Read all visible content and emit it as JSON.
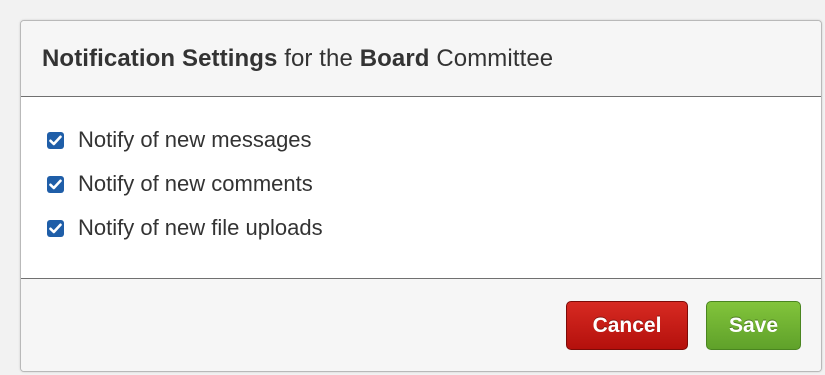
{
  "dialog": {
    "title_bold_1": "Notification Settings",
    "title_text_1": " for the ",
    "title_bold_2": "Board",
    "title_text_2": " Committee"
  },
  "options": [
    {
      "label": "Notify of new messages",
      "checked": true
    },
    {
      "label": "Notify of new comments",
      "checked": true
    },
    {
      "label": "Notify of new file uploads",
      "checked": true
    }
  ],
  "footer": {
    "cancel_label": "Cancel",
    "save_label": "Save"
  },
  "colors": {
    "checkbox": "#1f5ea8",
    "cancel": "#c41a14",
    "save": "#72b534"
  },
  "icons": {
    "checkbox_checked": "checkmark-icon"
  }
}
